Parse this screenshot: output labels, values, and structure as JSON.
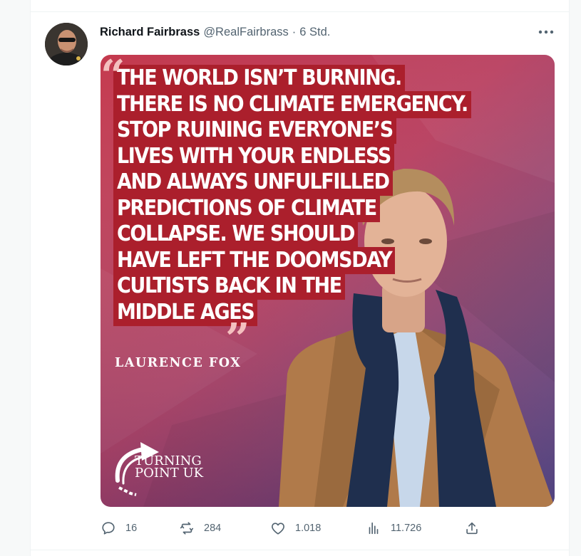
{
  "tweet": {
    "author_name": "Richard Fairbrass",
    "handle": "@RealFairbrass",
    "separator": "·",
    "time": "6 Std."
  },
  "media": {
    "quote_lines": [
      "THE WORLD ISN’T BURNING.",
      "THERE IS NO CLIMATE EMERGENCY.",
      "STOP RUINING EVERYONE’S",
      "LIVES WITH YOUR ENDLESS",
      "AND ALWAYS UNFULFILLED",
      "PREDICTIONS OF CLIMATE",
      "COLLAPSE. WE SHOULD",
      "HAVE LEFT THE DOOMSDAY",
      "CULTISTS BACK IN THE",
      "MIDDLE AGES"
    ],
    "attribution": "LAURENCE FOX",
    "logo_line1": "TURNING",
    "logo_line2": "POINT UK"
  },
  "actions": {
    "replies": "16",
    "retweets": "284",
    "likes": "1.018",
    "views": "11.726"
  },
  "colors": {
    "quote_background": "#ab1f2c",
    "secondary_text": "#536471"
  }
}
